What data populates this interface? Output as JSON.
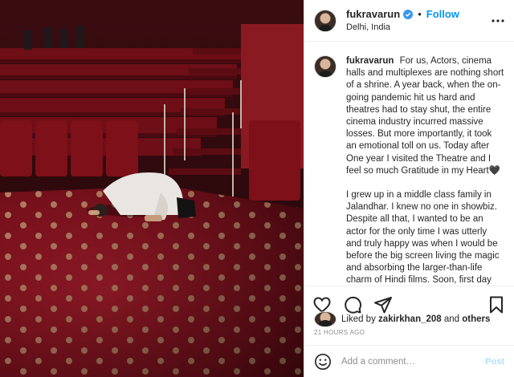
{
  "post": {
    "username": "fukravarun",
    "follow_label": "Follow",
    "separator": "•",
    "location": "Delhi, India",
    "caption_p1": "For us, Actors, cinema halls and multiplexes are nothing short of a shrine. A year back, when the on-going pandemic hit us hard and theatres had to stay shut, the entire cinema industry incurred massive losses. But more importantly, it took an emotional toll on us. Today after One year I visited the Theatre and I feel so much Gratitude in my Heart🖤",
    "caption_p2": "I grew up in a middle class family in Jalandhar. I knew no one in showbiz. Despite all that, I wanted to be an actor for the only time I was utterly and truly happy was when I would be before the big screen living the magic and absorbing the larger-than-life charm of Hindi films. Soon, first day first show became a ritual for me."
  },
  "likes": {
    "prefix": "Liked by",
    "user": "zakirkhan_208",
    "connector": "and",
    "others": "others"
  },
  "timestamp": "21 HOURS AGO",
  "comment": {
    "placeholder": "Add a comment…",
    "post_label": "Post"
  },
  "icons": {
    "verified": "verified-badge-icon",
    "more": "more-options-icon",
    "like": "heart-icon",
    "comment": "comment-icon",
    "share": "share-icon",
    "save": "bookmark-icon",
    "emoji": "emoji-icon"
  },
  "colors": {
    "accent": "#0095f6",
    "post_disabled": "#b2dffc",
    "muted": "#8e8e8e",
    "carpet": "#8a1522",
    "seat": "#7d1018"
  }
}
